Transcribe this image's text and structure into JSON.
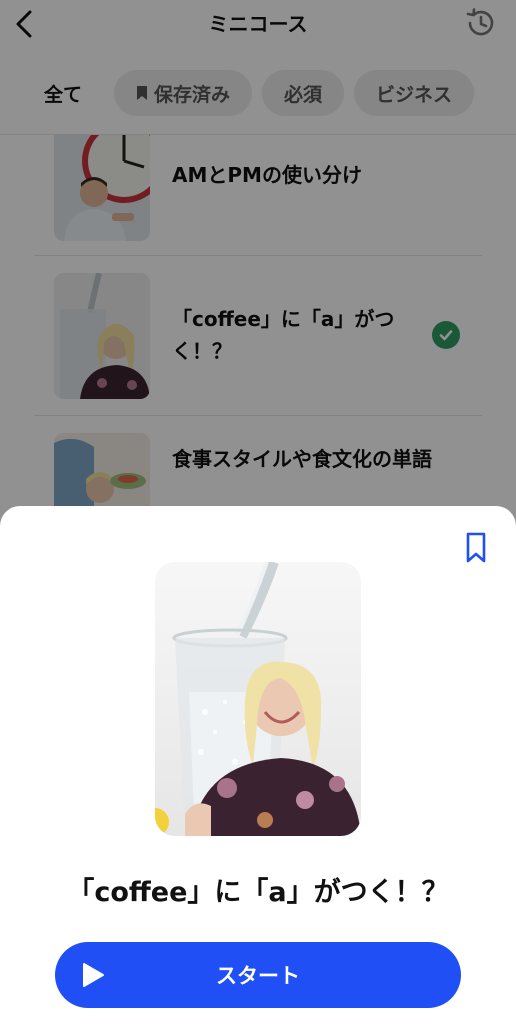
{
  "header": {
    "title": "ミニコース"
  },
  "filters": [
    {
      "label": "全て",
      "active": true
    },
    {
      "label": "保存済み",
      "icon": "bookmark-icon"
    },
    {
      "label": "必須"
    },
    {
      "label": "ビジネス"
    }
  ],
  "courses": [
    {
      "title": "AMとPMの使い分け",
      "completed": false
    },
    {
      "title": "「coffee」に「a」がつく！？",
      "completed": true
    },
    {
      "title": "食事スタイルや食文化の単語",
      "completed": false
    }
  ],
  "sheet": {
    "title": "「coffee」に「a」がつく！？",
    "start_label": "スタート"
  },
  "colors": {
    "accent": "#1f4ff5",
    "check": "#2f9c63",
    "bookmark": "#1f4ff5"
  }
}
